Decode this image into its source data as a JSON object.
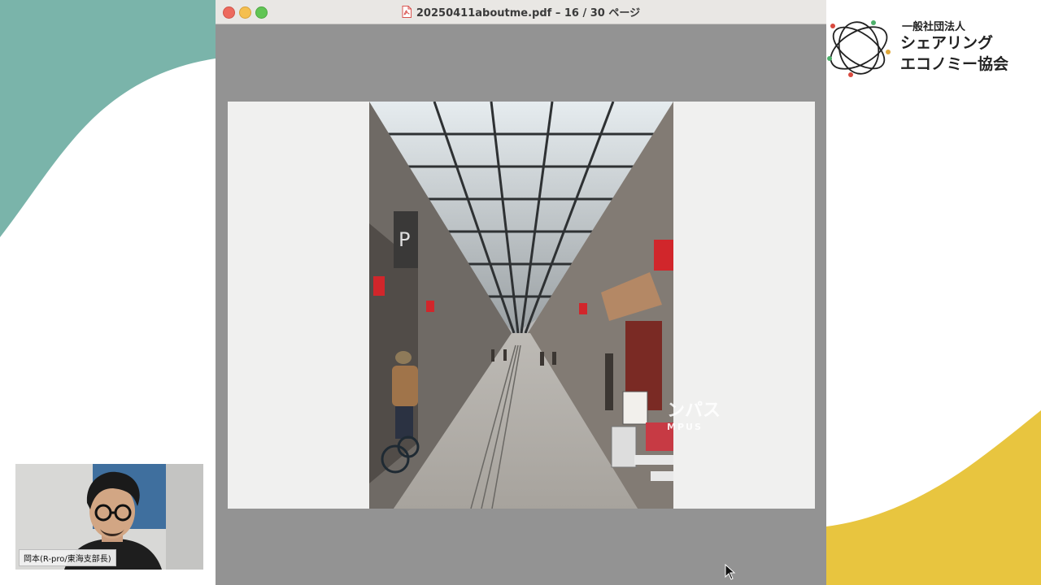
{
  "colors": {
    "teal_shape": "#7ab4aa",
    "yellow_shape": "#e8c53f",
    "window_bg": "#939393"
  },
  "pdf_viewer": {
    "file_icon": "pdf-file-icon",
    "file_name": "20250411aboutme.pdf – 16 / 30 ページ"
  },
  "slide": {
    "photo_description_icon": "shopping-arcade-photo",
    "watermark_main": "ンパス",
    "watermark_sub": "MPUS"
  },
  "logo": {
    "subtitle": "一般社団法人",
    "line1": "シェアリング",
    "line2": "エコノミー協会"
  },
  "webcam": {
    "participant_name": "岡本(R-pro/東海支部長)"
  }
}
